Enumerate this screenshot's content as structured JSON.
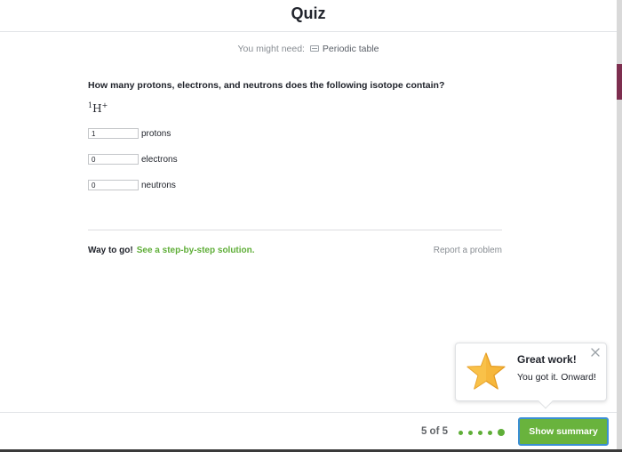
{
  "header": {
    "title": "Quiz"
  },
  "resources": {
    "label": "You might need:",
    "icon": "periodic-table-icon",
    "link_label": "Periodic table"
  },
  "question": {
    "prompt": "How many protons, electrons, and neutrons does the following isotope contain?",
    "formula": {
      "mass_number": "1",
      "symbol": "H",
      "charge": "+"
    },
    "answers": [
      {
        "value": "1",
        "unit": "protons"
      },
      {
        "value": "0",
        "unit": "electrons"
      },
      {
        "value": "0",
        "unit": "neutrons"
      }
    ]
  },
  "feedback": {
    "message": "Way to go!",
    "solution_link": "See a step-by-step solution.",
    "report_link": "Report a problem"
  },
  "popup": {
    "icon": "star-icon",
    "title": "Great work!",
    "text": "You got it. Onward!",
    "close_icon": "close-icon"
  },
  "footer": {
    "progress_text": "5 of 5",
    "total_questions": 5,
    "current_question": 5,
    "button_label": "Show summary"
  },
  "colors": {
    "accent_green": "#69b33d",
    "link_green": "#5fae38",
    "focus_blue": "#3b8fd5",
    "star_gold": "#f6b73c"
  }
}
